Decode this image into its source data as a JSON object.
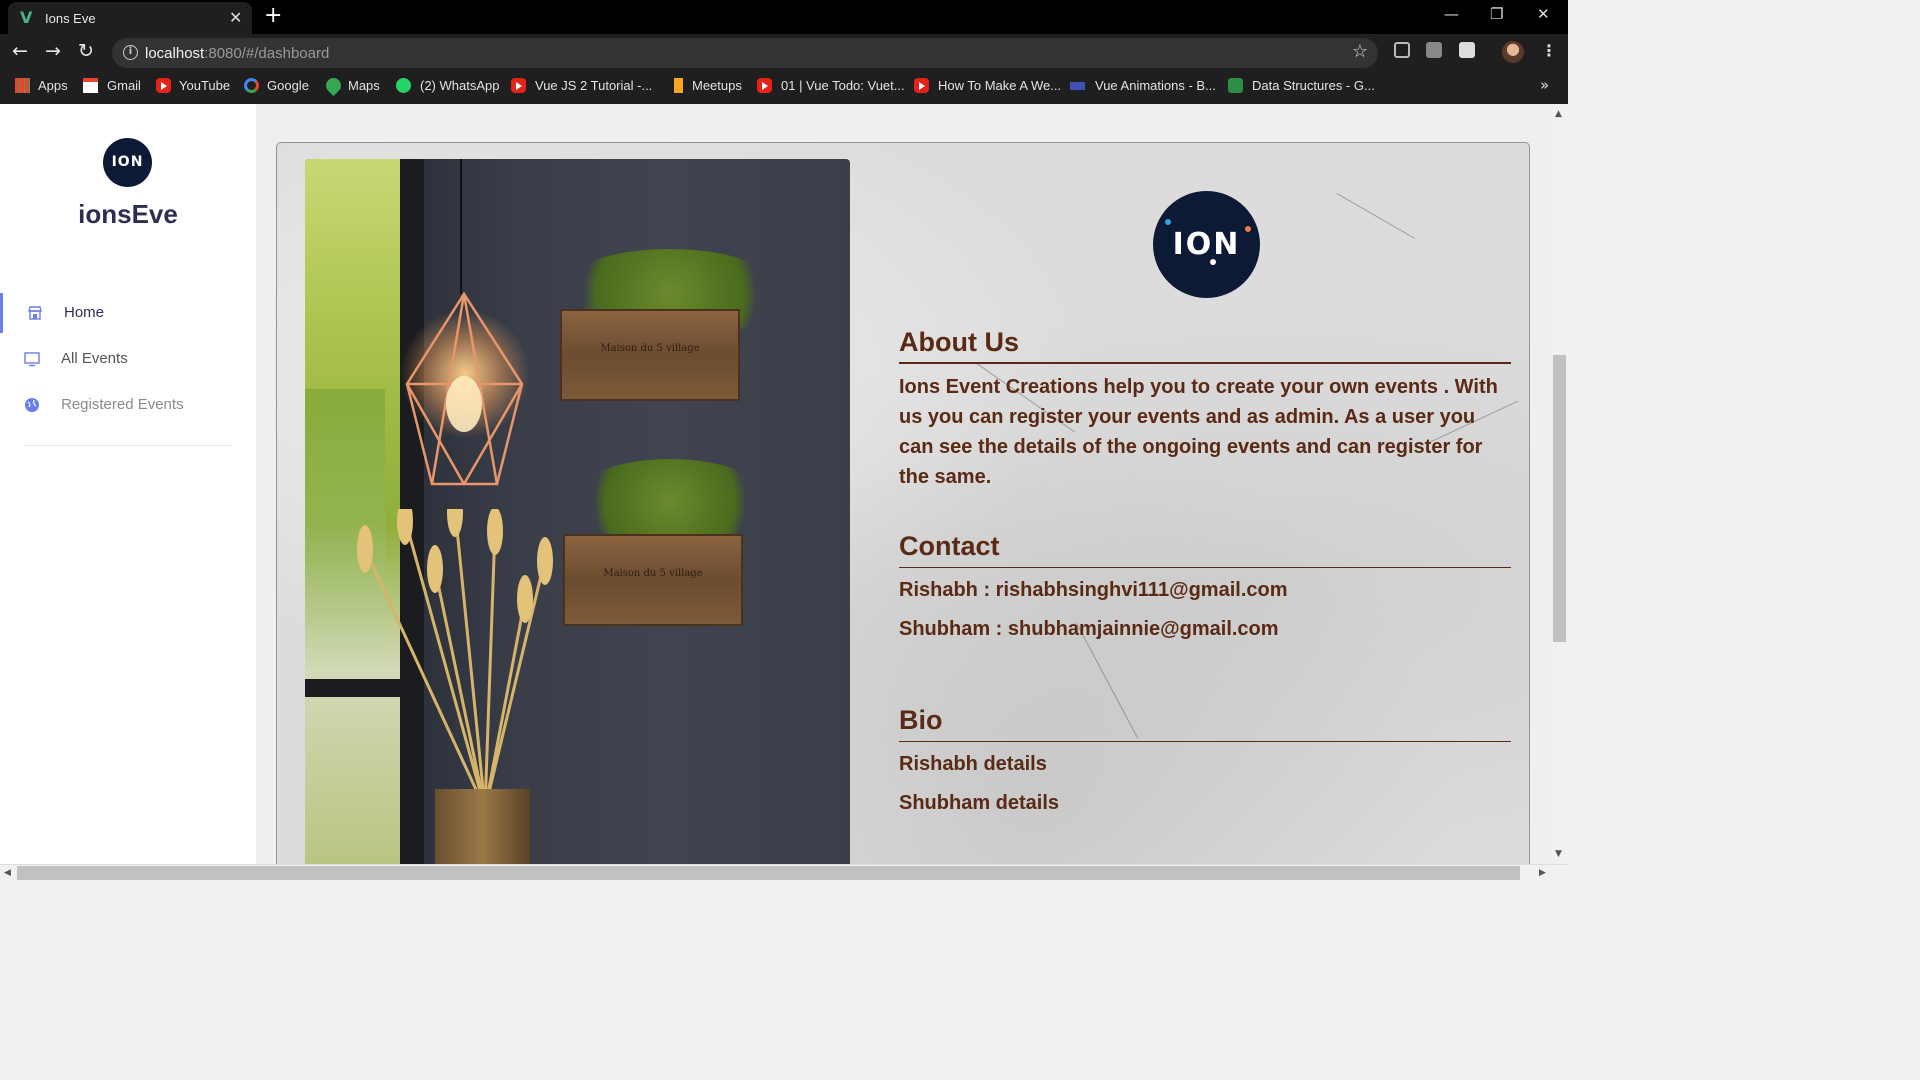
{
  "browser": {
    "tab_title": "Ions Eve",
    "tab_favicon": "V",
    "url_host": "localhost",
    "url_path": ":8080/#/dashboard",
    "bookmarks": [
      {
        "label": "Apps",
        "icon": "apps-grid-icon"
      },
      {
        "label": "Gmail",
        "icon": "gmail-icon"
      },
      {
        "label": "YouTube",
        "icon": "youtube-icon"
      },
      {
        "label": "Google",
        "icon": "google-icon"
      },
      {
        "label": "Maps",
        "icon": "maps-pin-icon"
      },
      {
        "label": "(2) WhatsApp",
        "icon": "whatsapp-icon"
      },
      {
        "label": "Vue JS 2 Tutorial -...",
        "icon": "youtube-icon"
      },
      {
        "label": "Meetups",
        "icon": "bookmark-icon"
      },
      {
        "label": "01 | Vue Todo: Vuet...",
        "icon": "youtube-icon"
      },
      {
        "label": "How To Make A We...",
        "icon": "youtube-icon"
      },
      {
        "label": "Vue Animations - B...",
        "icon": "mdb-icon"
      },
      {
        "label": "Data Structures - G...",
        "icon": "gfg-icon"
      }
    ]
  },
  "sidebar": {
    "logo_text": "ION",
    "brand": "ionsEve",
    "items": [
      {
        "label": "Home",
        "icon": "store-icon",
        "active": true
      },
      {
        "label": "All Events",
        "icon": "monitor-icon",
        "active": false
      },
      {
        "label": "Registered Events",
        "icon": "globe-icon",
        "active": false
      }
    ]
  },
  "main": {
    "photo_box_text": "Maison du 5 village",
    "logo_text": "ION",
    "about": {
      "heading": "About Us",
      "text": "Ions Event Creations help you to create your own events . With us you can register your events and as admin. As a user you can see the details of the ongoing events and can register for the same."
    },
    "contact": {
      "heading": "Contact",
      "lines": [
        "Rishabh : rishabhsinghvi111@gmail.com",
        "Shubham : shubhamjainnie@gmail.com"
      ]
    },
    "bio": {
      "heading": "Bio",
      "lines": [
        "Rishabh details",
        "Shubham details"
      ]
    }
  },
  "colors": {
    "accent": "#6b7de8",
    "text_brown": "#5a2a14",
    "brand_navy": "#0c1a36"
  }
}
